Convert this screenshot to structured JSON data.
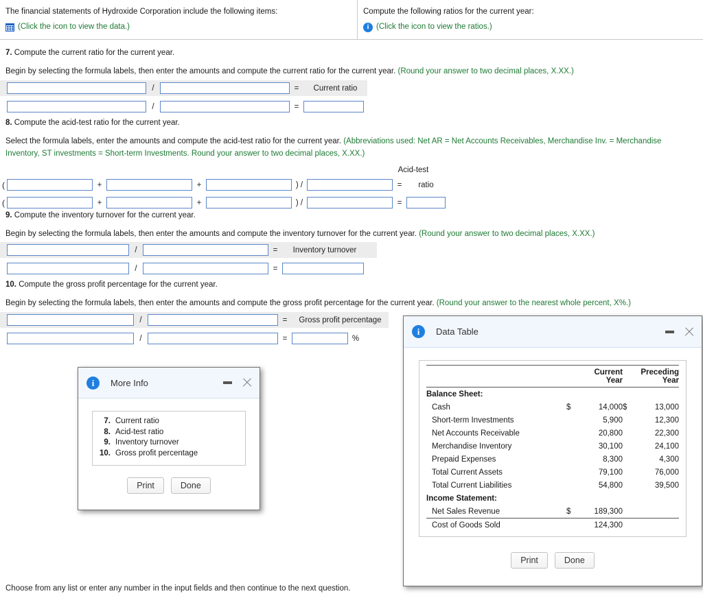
{
  "header": {
    "left_text": "The financial statements of Hydroxide Corporation include the following items:",
    "left_link": "(Click the icon to view the data.)",
    "left_icon": "grid-icon",
    "right_text": "Compute the following ratios for the current year:",
    "right_link": "(Click the icon to view the ratios.)",
    "right_icon": "info-icon"
  },
  "questions": [
    {
      "number": "7.",
      "title": "Compute the current ratio for the current year.",
      "instruction": "Begin by selecting the formula labels, then enter the amounts and compute the current ratio for the current year. ",
      "note": "(Round your answer to two decimal places, X.XX.)",
      "result_label": "Current ratio",
      "op_divide": "/",
      "op_equals": "=",
      "fields": {
        "numerator": "",
        "denominator": "",
        "answer": ""
      }
    },
    {
      "number": "8.",
      "title": "Compute the acid-test ratio for the current year.",
      "instruction": "Select the formula labels, enter the amounts and compute the acid-test ratio for the current year. ",
      "note": "(Abbreviations used: Net AR = Net Accounts Receivables, Merchandise Inv. = Merchandise Inventory, ST investments = Short-term Investments. Round your answer to two decimal places, X.XX.)",
      "result_label_line1": "Acid-test",
      "result_label_line2": "ratio",
      "op_plus": "+",
      "op_open_paren": "(",
      "op_close_divide": ") /",
      "op_equals": "=",
      "fields": {
        "a": "",
        "b": "",
        "c": "",
        "denominator": "",
        "answer": ""
      }
    },
    {
      "number": "9.",
      "title": "Compute the inventory turnover for the current year.",
      "instruction": "Begin by selecting the formula labels, then enter the amounts and compute the inventory turnover for the current year. ",
      "note": "(Round your answer to two decimal places, X.XX.)",
      "result_label": "Inventory turnover",
      "op_divide": "/",
      "op_equals": "=",
      "fields": {
        "numerator": "",
        "denominator": "",
        "answer": ""
      }
    },
    {
      "number": "10.",
      "title": "Compute the gross profit percentage for the current year.",
      "instruction": "Begin by selecting the formula labels, then enter the amounts and compute the gross profit percentage for the current year. ",
      "note": "(Round your answer to the nearest whole percent, X%.)",
      "result_label": "Gross profit percentage",
      "op_divide": "/",
      "op_equals": "=",
      "percent_sign": "%",
      "fields": {
        "numerator": "",
        "denominator": "",
        "answer": ""
      }
    }
  ],
  "more_info_dialog": {
    "title": "More Info",
    "icon": "info-icon",
    "items": [
      {
        "num": "7.",
        "label": "Current ratio"
      },
      {
        "num": "8.",
        "label": "Acid-test ratio"
      },
      {
        "num": "9.",
        "label": "Inventory turnover"
      },
      {
        "num": "10.",
        "label": "Gross profit percentage"
      }
    ],
    "print_label": "Print",
    "done_label": "Done"
  },
  "data_table_dialog": {
    "title": "Data Table",
    "icon": "info-icon",
    "columns": [
      "",
      "Current Year",
      "Preceding Year"
    ],
    "rows": [
      {
        "type": "section",
        "label": "Balance Sheet:"
      },
      {
        "type": "item",
        "label": "Cash",
        "dollar_cur": "$",
        "current": "14,000",
        "dollar_pre": "$",
        "preceding": "13,000"
      },
      {
        "type": "item",
        "label": "Short-term Investments",
        "dollar_cur": "",
        "current": "5,900",
        "dollar_pre": "",
        "preceding": "12,300"
      },
      {
        "type": "item",
        "label": "Net Accounts Receivable",
        "dollar_cur": "",
        "current": "20,800",
        "dollar_pre": "",
        "preceding": "22,300"
      },
      {
        "type": "item",
        "label": "Merchandise Inventory",
        "dollar_cur": "",
        "current": "30,100",
        "dollar_pre": "",
        "preceding": "24,100"
      },
      {
        "type": "item",
        "label": "Prepaid Expenses",
        "dollar_cur": "",
        "current": "8,300",
        "dollar_pre": "",
        "preceding": "4,300"
      },
      {
        "type": "item",
        "label": "Total Current Assets",
        "dollar_cur": "",
        "current": "79,100",
        "dollar_pre": "",
        "preceding": "76,000"
      },
      {
        "type": "item",
        "label": "Total Current Liabilities",
        "dollar_cur": "",
        "current": "54,800",
        "dollar_pre": "",
        "preceding": "39,500"
      },
      {
        "type": "section",
        "label": "Income Statement:"
      },
      {
        "type": "item",
        "label": "Net Sales Revenue",
        "dollar_cur": "$",
        "current": "189,300",
        "dollar_pre": "",
        "preceding": ""
      },
      {
        "type": "item",
        "label": "Cost of Goods Sold",
        "dollar_cur": "",
        "current": "124,300",
        "dollar_pre": "",
        "preceding": ""
      }
    ],
    "print_label": "Print",
    "done_label": "Done"
  },
  "footer": {
    "note": "Choose from any list or enter any number in the input fields and then continue to the next question."
  },
  "colors": {
    "link_green": "#1d7a33",
    "icon_blue": "#1f7fe0",
    "field_border": "#5b86c9",
    "shade": "#ececec"
  }
}
